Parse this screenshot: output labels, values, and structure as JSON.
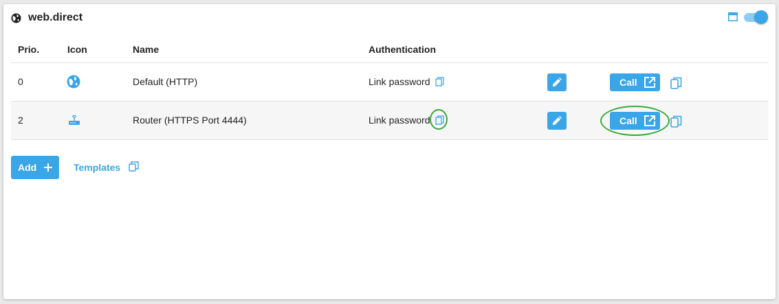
{
  "panel": {
    "title": "web.direct"
  },
  "table": {
    "columns": [
      "Prio.",
      "Icon",
      "Name",
      "Authentication"
    ],
    "rows": [
      {
        "prio": "0",
        "icon": "globe-icon",
        "name": "Default (HTTP)",
        "auth": "Link password",
        "call_label": "Call"
      },
      {
        "prio": "2",
        "icon": "router-icon",
        "name": "Router (HTTPS Port 4444)",
        "auth": "Link password",
        "call_label": "Call"
      }
    ]
  },
  "footer": {
    "add_label": "Add",
    "templates_label": "Templates"
  },
  "colors": {
    "accent": "#3aa6e8",
    "highlight": "#3aa83a"
  },
  "toggle": {
    "on": true
  }
}
